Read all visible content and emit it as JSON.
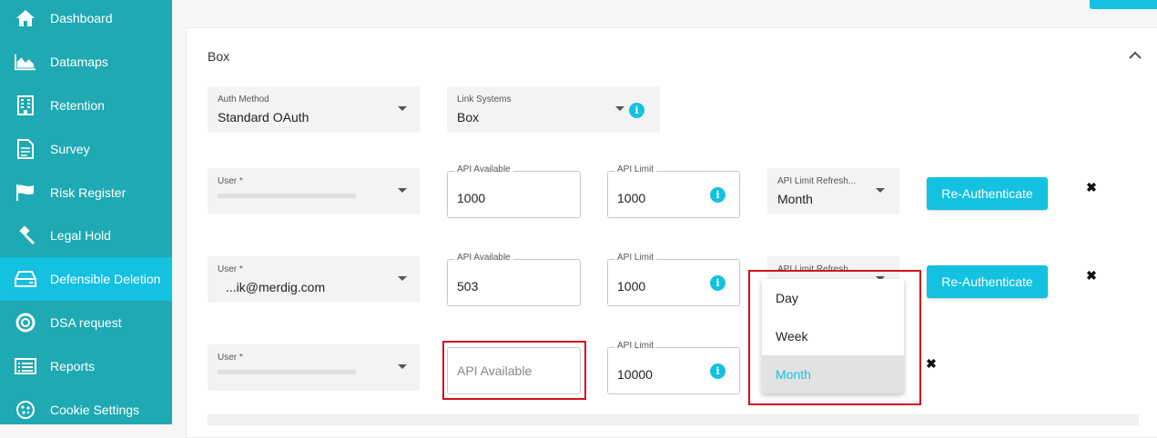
{
  "sidebar": {
    "items": [
      {
        "label": "Dashboard",
        "icon": "home-icon"
      },
      {
        "label": "Datamaps",
        "icon": "area-chart-icon"
      },
      {
        "label": "Retention",
        "icon": "building-icon"
      },
      {
        "label": "Survey",
        "icon": "document-icon"
      },
      {
        "label": "Risk Register",
        "icon": "flag-icon"
      },
      {
        "label": "Legal Hold",
        "icon": "gavel-icon"
      },
      {
        "label": "Defensible Deletion",
        "icon": "drive-icon",
        "active": true
      },
      {
        "label": "DSA request",
        "icon": "lifebuoy-icon"
      },
      {
        "label": "Reports",
        "icon": "list-icon"
      },
      {
        "label": "Cookie Settings",
        "icon": "cookie-icon"
      }
    ],
    "bg": "#1ea9b3",
    "active_bg": "#14c1e0"
  },
  "card": {
    "title": "Box",
    "auth_method": {
      "label": "Auth Method",
      "value": "Standard OAuth"
    },
    "link_systems": {
      "label": "Link Systems",
      "value": "Box"
    }
  },
  "rows": [
    {
      "user_label": "User *",
      "user_value": "",
      "api_available_label": "API Available",
      "api_available_value": "1000",
      "api_limit_label": "API Limit",
      "api_limit_value": "1000",
      "refresh_label": "API Limit Refresh...",
      "refresh_value": "Month",
      "button": "Re-Authenticate"
    },
    {
      "user_label": "User *",
      "user_value": "...ik@merdig.com",
      "api_available_label": "API Available",
      "api_available_value": "503",
      "api_limit_label": "API Limit",
      "api_limit_value": "1000",
      "refresh_label": "API Limit Refresh...",
      "refresh_value": "",
      "button": "Re-Authenticate"
    },
    {
      "user_label": "User *",
      "user_value": "",
      "api_available_placeholder": "API Available",
      "api_limit_label": "API Limit",
      "api_limit_value": "10000"
    }
  ],
  "dropdown": {
    "options": [
      "Day",
      "Week",
      "Month"
    ],
    "selected": "Month"
  },
  "accent": "#14c1e0",
  "highlight": "#d0121b"
}
